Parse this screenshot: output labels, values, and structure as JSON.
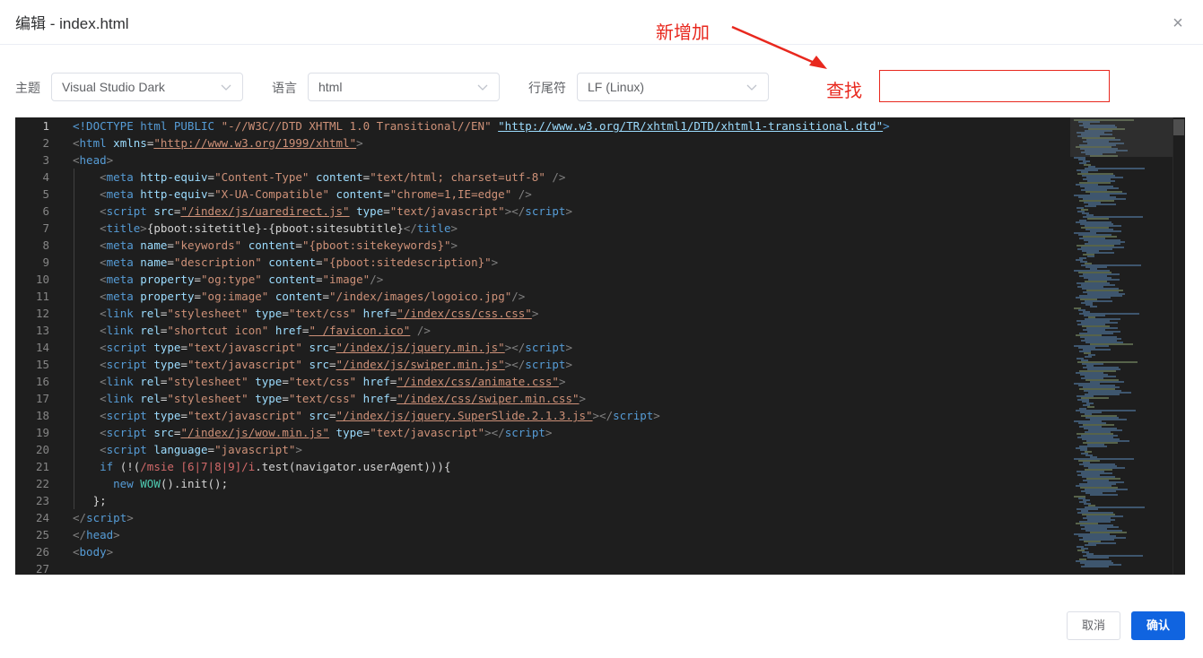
{
  "dialog": {
    "title": "编辑 - index.html",
    "close_label": "×"
  },
  "annotation": {
    "text": "新增加",
    "color": "#e8281e"
  },
  "toolbar": {
    "theme_label": "主题",
    "theme_value": "Visual Studio Dark",
    "language_label": "语言",
    "language_value": "html",
    "eol_label": "行尾符",
    "eol_value": "LF (Linux)",
    "find_label": "查找",
    "find_value": ""
  },
  "editor": {
    "line_numbers": [
      "1",
      "2",
      "3",
      "4",
      "5",
      "6",
      "7",
      "8",
      "9",
      "10",
      "11",
      "12",
      "13",
      "14",
      "15",
      "16",
      "17",
      "18",
      "19",
      "20",
      "21",
      "22",
      "23",
      "24",
      "25",
      "26",
      "27"
    ],
    "active_line": 1,
    "lines": [
      [
        [
          "c-doc",
          "<!DOCTYPE html PUBLIC "
        ],
        [
          "c-str",
          "\"-//W3C//DTD XHTML 1.0 Transitional//EN\""
        ],
        [
          "c-txt",
          " "
        ],
        [
          "c-link2",
          "\"http://www.w3.org/TR/xhtml1/DTD/xhtml1-transitional.dtd\""
        ],
        [
          "c-doc",
          ">"
        ]
      ],
      [
        [
          "c-punct",
          "<"
        ],
        [
          "c-tag",
          "html"
        ],
        [
          "c-txt",
          " "
        ],
        [
          "c-attr",
          "xmlns"
        ],
        [
          "c-txt",
          "="
        ],
        [
          "c-link",
          "\"http://www.w3.org/1999/xhtml\""
        ],
        [
          "c-punct",
          ">"
        ]
      ],
      [
        [
          "c-punct",
          "<"
        ],
        [
          "c-tag",
          "head"
        ],
        [
          "c-punct",
          ">"
        ]
      ],
      [
        [
          "c-txt",
          "    "
        ],
        [
          "c-punct",
          "<"
        ],
        [
          "c-tag",
          "meta"
        ],
        [
          "c-txt",
          " "
        ],
        [
          "c-attr",
          "http-equiv"
        ],
        [
          "c-txt",
          "="
        ],
        [
          "c-str",
          "\"Content-Type\""
        ],
        [
          "c-txt",
          " "
        ],
        [
          "c-attr",
          "content"
        ],
        [
          "c-txt",
          "="
        ],
        [
          "c-str",
          "\"text/html; charset=utf-8\""
        ],
        [
          "c-txt",
          " "
        ],
        [
          "c-punct",
          "/>"
        ]
      ],
      [
        [
          "c-txt",
          "    "
        ],
        [
          "c-punct",
          "<"
        ],
        [
          "c-tag",
          "meta"
        ],
        [
          "c-txt",
          " "
        ],
        [
          "c-attr",
          "http-equiv"
        ],
        [
          "c-txt",
          "="
        ],
        [
          "c-str",
          "\"X-UA-Compatible\""
        ],
        [
          "c-txt",
          " "
        ],
        [
          "c-attr",
          "content"
        ],
        [
          "c-txt",
          "="
        ],
        [
          "c-str",
          "\"chrome=1,IE=edge\""
        ],
        [
          "c-txt",
          " "
        ],
        [
          "c-punct",
          "/>"
        ]
      ],
      [
        [
          "c-txt",
          "    "
        ],
        [
          "c-punct",
          "<"
        ],
        [
          "c-tag",
          "script"
        ],
        [
          "c-txt",
          " "
        ],
        [
          "c-attr",
          "src"
        ],
        [
          "c-txt",
          "="
        ],
        [
          "c-link",
          "\"/index/js/uaredirect.js\""
        ],
        [
          "c-txt",
          " "
        ],
        [
          "c-attr",
          "type"
        ],
        [
          "c-txt",
          "="
        ],
        [
          "c-str",
          "\"text/javascript\""
        ],
        [
          "c-punct",
          ">"
        ],
        [
          "c-punct",
          "</"
        ],
        [
          "c-tag",
          "script"
        ],
        [
          "c-punct",
          ">"
        ]
      ],
      [
        [
          "c-txt",
          "    "
        ],
        [
          "c-punct",
          "<"
        ],
        [
          "c-tag",
          "title"
        ],
        [
          "c-punct",
          ">"
        ],
        [
          "c-txt",
          "{pboot:sitetitle}-{pboot:sitesubtitle}"
        ],
        [
          "c-punct",
          "</"
        ],
        [
          "c-tag",
          "title"
        ],
        [
          "c-punct",
          ">"
        ]
      ],
      [
        [
          "c-txt",
          "    "
        ],
        [
          "c-punct",
          "<"
        ],
        [
          "c-tag",
          "meta"
        ],
        [
          "c-txt",
          " "
        ],
        [
          "c-attr",
          "name"
        ],
        [
          "c-txt",
          "="
        ],
        [
          "c-str",
          "\"keywords\""
        ],
        [
          "c-txt",
          " "
        ],
        [
          "c-attr",
          "content"
        ],
        [
          "c-txt",
          "="
        ],
        [
          "c-str",
          "\"{pboot:sitekeywords}\""
        ],
        [
          "c-punct",
          ">"
        ]
      ],
      [
        [
          "c-txt",
          "    "
        ],
        [
          "c-punct",
          "<"
        ],
        [
          "c-tag",
          "meta"
        ],
        [
          "c-txt",
          " "
        ],
        [
          "c-attr",
          "name"
        ],
        [
          "c-txt",
          "="
        ],
        [
          "c-str",
          "\"description\""
        ],
        [
          "c-txt",
          " "
        ],
        [
          "c-attr",
          "content"
        ],
        [
          "c-txt",
          "="
        ],
        [
          "c-str",
          "\"{pboot:sitedescription}\""
        ],
        [
          "c-punct",
          ">"
        ]
      ],
      [
        [
          "c-txt",
          "    "
        ],
        [
          "c-punct",
          "<"
        ],
        [
          "c-tag",
          "meta"
        ],
        [
          "c-txt",
          " "
        ],
        [
          "c-attr",
          "property"
        ],
        [
          "c-txt",
          "="
        ],
        [
          "c-str",
          "\"og:type\""
        ],
        [
          "c-txt",
          " "
        ],
        [
          "c-attr",
          "content"
        ],
        [
          "c-txt",
          "="
        ],
        [
          "c-str",
          "\"image\""
        ],
        [
          "c-punct",
          "/>"
        ]
      ],
      [
        [
          "c-txt",
          "    "
        ],
        [
          "c-punct",
          "<"
        ],
        [
          "c-tag",
          "meta"
        ],
        [
          "c-txt",
          " "
        ],
        [
          "c-attr",
          "property"
        ],
        [
          "c-txt",
          "="
        ],
        [
          "c-str",
          "\"og:image\""
        ],
        [
          "c-txt",
          " "
        ],
        [
          "c-attr",
          "content"
        ],
        [
          "c-txt",
          "="
        ],
        [
          "c-str",
          "\"/index/images/logoico.jpg\""
        ],
        [
          "c-punct",
          "/>"
        ]
      ],
      [
        [
          "c-txt",
          "    "
        ],
        [
          "c-punct",
          "<"
        ],
        [
          "c-tag",
          "link"
        ],
        [
          "c-txt",
          " "
        ],
        [
          "c-attr",
          "rel"
        ],
        [
          "c-txt",
          "="
        ],
        [
          "c-str",
          "\"stylesheet\""
        ],
        [
          "c-txt",
          " "
        ],
        [
          "c-attr",
          "type"
        ],
        [
          "c-txt",
          "="
        ],
        [
          "c-str",
          "\"text/css\""
        ],
        [
          "c-txt",
          " "
        ],
        [
          "c-attr",
          "href"
        ],
        [
          "c-txt",
          "="
        ],
        [
          "c-link",
          "\"/index/css/css.css\""
        ],
        [
          "c-punct",
          ">"
        ]
      ],
      [
        [
          "c-txt",
          "    "
        ],
        [
          "c-punct",
          "<"
        ],
        [
          "c-tag",
          "link"
        ],
        [
          "c-txt",
          " "
        ],
        [
          "c-attr",
          "rel"
        ],
        [
          "c-txt",
          "="
        ],
        [
          "c-str",
          "\"shortcut icon\""
        ],
        [
          "c-txt",
          " "
        ],
        [
          "c-attr",
          "href"
        ],
        [
          "c-txt",
          "="
        ],
        [
          "c-link",
          "\" /favicon.ico\""
        ],
        [
          "c-txt",
          " "
        ],
        [
          "c-punct",
          "/>"
        ]
      ],
      [
        [
          "c-txt",
          "    "
        ],
        [
          "c-punct",
          "<"
        ],
        [
          "c-tag",
          "script"
        ],
        [
          "c-txt",
          " "
        ],
        [
          "c-attr",
          "type"
        ],
        [
          "c-txt",
          "="
        ],
        [
          "c-str",
          "\"text/javascript\""
        ],
        [
          "c-txt",
          " "
        ],
        [
          "c-attr",
          "src"
        ],
        [
          "c-txt",
          "="
        ],
        [
          "c-link",
          "\"/index/js/jquery.min.js\""
        ],
        [
          "c-punct",
          ">"
        ],
        [
          "c-punct",
          "</"
        ],
        [
          "c-tag",
          "script"
        ],
        [
          "c-punct",
          ">"
        ]
      ],
      [
        [
          "c-txt",
          "    "
        ],
        [
          "c-punct",
          "<"
        ],
        [
          "c-tag",
          "script"
        ],
        [
          "c-txt",
          " "
        ],
        [
          "c-attr",
          "type"
        ],
        [
          "c-txt",
          "="
        ],
        [
          "c-str",
          "\"text/javascript\""
        ],
        [
          "c-txt",
          " "
        ],
        [
          "c-attr",
          "src"
        ],
        [
          "c-txt",
          "="
        ],
        [
          "c-link",
          "\"/index/js/swiper.min.js\""
        ],
        [
          "c-punct",
          ">"
        ],
        [
          "c-punct",
          "</"
        ],
        [
          "c-tag",
          "script"
        ],
        [
          "c-punct",
          ">"
        ]
      ],
      [
        [
          "c-txt",
          "    "
        ],
        [
          "c-punct",
          "<"
        ],
        [
          "c-tag",
          "link"
        ],
        [
          "c-txt",
          " "
        ],
        [
          "c-attr",
          "rel"
        ],
        [
          "c-txt",
          "="
        ],
        [
          "c-str",
          "\"stylesheet\""
        ],
        [
          "c-txt",
          " "
        ],
        [
          "c-attr",
          "type"
        ],
        [
          "c-txt",
          "="
        ],
        [
          "c-str",
          "\"text/css\""
        ],
        [
          "c-txt",
          " "
        ],
        [
          "c-attr",
          "href"
        ],
        [
          "c-txt",
          "="
        ],
        [
          "c-link",
          "\"/index/css/animate.css\""
        ],
        [
          "c-punct",
          ">"
        ]
      ],
      [
        [
          "c-txt",
          "    "
        ],
        [
          "c-punct",
          "<"
        ],
        [
          "c-tag",
          "link"
        ],
        [
          "c-txt",
          " "
        ],
        [
          "c-attr",
          "rel"
        ],
        [
          "c-txt",
          "="
        ],
        [
          "c-str",
          "\"stylesheet\""
        ],
        [
          "c-txt",
          " "
        ],
        [
          "c-attr",
          "type"
        ],
        [
          "c-txt",
          "="
        ],
        [
          "c-str",
          "\"text/css\""
        ],
        [
          "c-txt",
          " "
        ],
        [
          "c-attr",
          "href"
        ],
        [
          "c-txt",
          "="
        ],
        [
          "c-link",
          "\"/index/css/swiper.min.css\""
        ],
        [
          "c-punct",
          ">"
        ]
      ],
      [
        [
          "c-txt",
          "    "
        ],
        [
          "c-punct",
          "<"
        ],
        [
          "c-tag",
          "script"
        ],
        [
          "c-txt",
          " "
        ],
        [
          "c-attr",
          "type"
        ],
        [
          "c-txt",
          "="
        ],
        [
          "c-str",
          "\"text/javascript\""
        ],
        [
          "c-txt",
          " "
        ],
        [
          "c-attr",
          "src"
        ],
        [
          "c-txt",
          "="
        ],
        [
          "c-link",
          "\"/index/js/jquery.SuperSlide.2.1.3.js\""
        ],
        [
          "c-punct",
          ">"
        ],
        [
          "c-punct",
          "</"
        ],
        [
          "c-tag",
          "script"
        ],
        [
          "c-punct",
          ">"
        ]
      ],
      [
        [
          "c-txt",
          "    "
        ],
        [
          "c-punct",
          "<"
        ],
        [
          "c-tag",
          "script"
        ],
        [
          "c-txt",
          " "
        ],
        [
          "c-attr",
          "src"
        ],
        [
          "c-txt",
          "="
        ],
        [
          "c-link",
          "\"/index/js/wow.min.js\""
        ],
        [
          "c-txt",
          " "
        ],
        [
          "c-attr",
          "type"
        ],
        [
          "c-txt",
          "="
        ],
        [
          "c-str",
          "\"text/javascript\""
        ],
        [
          "c-punct",
          ">"
        ],
        [
          "c-punct",
          "</"
        ],
        [
          "c-tag",
          "script"
        ],
        [
          "c-punct",
          ">"
        ]
      ],
      [
        [
          "c-txt",
          "    "
        ],
        [
          "c-punct",
          "<"
        ],
        [
          "c-tag",
          "script"
        ],
        [
          "c-txt",
          " "
        ],
        [
          "c-attr",
          "language"
        ],
        [
          "c-txt",
          "="
        ],
        [
          "c-str",
          "\"javascript\""
        ],
        [
          "c-punct",
          ">"
        ]
      ],
      [
        [
          "c-txt",
          "    "
        ],
        [
          "c-kw",
          "if"
        ],
        [
          "c-txt",
          " (!("
        ],
        [
          "c-regex",
          "/msie [6|7|8|9]/i"
        ],
        [
          "c-txt",
          "."
        ],
        [
          "c-txt",
          "test(navigator.userAgent))){"
        ]
      ],
      [
        [
          "c-txt",
          "      "
        ],
        [
          "c-kw",
          "new"
        ],
        [
          "c-txt",
          " "
        ],
        [
          "c-cls",
          "WOW"
        ],
        [
          "c-txt",
          "().init();"
        ]
      ],
      [
        [
          "c-txt",
          "   };"
        ]
      ],
      [
        [
          "c-punct",
          "</"
        ],
        [
          "c-tag",
          "script"
        ],
        [
          "c-punct",
          ">"
        ]
      ],
      [
        [
          "c-punct",
          "</"
        ],
        [
          "c-tag",
          "head"
        ],
        [
          "c-punct",
          ">"
        ]
      ],
      [
        [
          "c-punct",
          "<"
        ],
        [
          "c-tag",
          "body"
        ],
        [
          "c-punct",
          ">"
        ]
      ],
      [
        [
          "c-txt",
          ""
        ]
      ]
    ]
  },
  "footer": {
    "cancel_label": "取消",
    "confirm_label": "确认"
  },
  "colors": {
    "primary": "#1064e0",
    "annotation_red": "#e8281e",
    "editor_bg": "#1e1e1e"
  }
}
